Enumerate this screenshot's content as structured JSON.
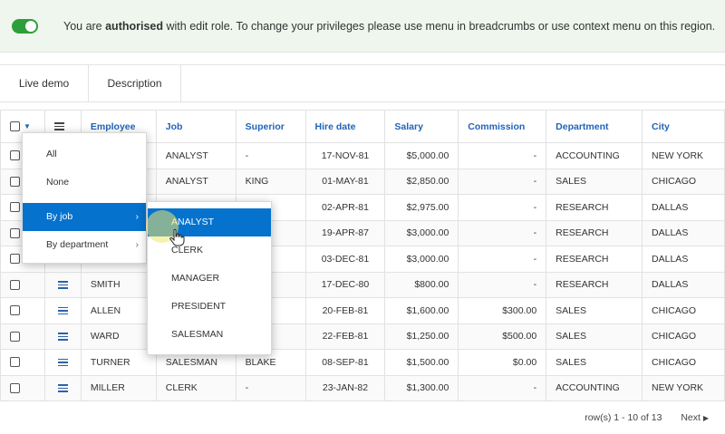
{
  "banner": {
    "msg_prefix": "You are ",
    "msg_bold": "authorised",
    "msg_suffix": " with edit role. To change your privileges please use menu in breadcrumbs or use context menu on this region.",
    "toggle_state": "on",
    "accent": "#2e9e3a"
  },
  "tabs": [
    {
      "label": "Live demo"
    },
    {
      "label": "Description"
    }
  ],
  "grid": {
    "headers": {
      "employee": "Employee",
      "job": "Job",
      "superior": "Superior",
      "hire_date": "Hire date",
      "salary": "Salary",
      "commission": "Commission",
      "department": "Department",
      "city": "City"
    },
    "rows": [
      {
        "employee": "",
        "job": "ANALYST",
        "superior": "-",
        "hire_date": "17-NOV-81",
        "salary": "$5,000.00",
        "commission": "-",
        "department": "ACCOUNTING",
        "city": "NEW YORK"
      },
      {
        "employee": "",
        "job": "ANALYST",
        "superior": "KING",
        "hire_date": "01-MAY-81",
        "salary": "$2,850.00",
        "commission": "-",
        "department": "SALES",
        "city": "CHICAGO"
      },
      {
        "employee": "",
        "job": "",
        "superior": "",
        "hire_date": "02-APR-81",
        "salary": "$2,975.00",
        "commission": "-",
        "department": "RESEARCH",
        "city": "DALLAS"
      },
      {
        "employee": "",
        "job": "",
        "superior": "",
        "hire_date": "19-APR-87",
        "salary": "$3,000.00",
        "commission": "-",
        "department": "RESEARCH",
        "city": "DALLAS"
      },
      {
        "employee": "",
        "job": "",
        "superior": "",
        "hire_date": "03-DEC-81",
        "salary": "$3,000.00",
        "commission": "-",
        "department": "RESEARCH",
        "city": "DALLAS"
      },
      {
        "employee": "SMITH",
        "job": "",
        "superior": "",
        "hire_date": "17-DEC-80",
        "salary": "$800.00",
        "commission": "-",
        "department": "RESEARCH",
        "city": "DALLAS"
      },
      {
        "employee": "ALLEN",
        "job": "",
        "superior": "",
        "hire_date": "20-FEB-81",
        "salary": "$1,600.00",
        "commission": "$300.00",
        "department": "SALES",
        "city": "CHICAGO"
      },
      {
        "employee": "WARD",
        "job": "",
        "superior": "",
        "hire_date": "22-FEB-81",
        "salary": "$1,250.00",
        "commission": "$500.00",
        "department": "SALES",
        "city": "CHICAGO"
      },
      {
        "employee": "TURNER",
        "job": "SALESMAN",
        "superior": "BLAKE",
        "hire_date": "08-SEP-81",
        "salary": "$1,500.00",
        "commission": "$0.00",
        "department": "SALES",
        "city": "CHICAGO"
      },
      {
        "employee": "MILLER",
        "job": "CLERK",
        "superior": "-",
        "hire_date": "23-JAN-82",
        "salary": "$1,300.00",
        "commission": "-",
        "department": "ACCOUNTING",
        "city": "NEW YORK"
      }
    ]
  },
  "pagination": {
    "range": "row(s) 1 - 10 of 13",
    "next": "Next"
  },
  "select_menu": {
    "items": [
      {
        "label": "All"
      },
      {
        "label": "None"
      },
      {
        "label": "By job",
        "has_submenu": true,
        "active": true
      },
      {
        "label": "By department",
        "has_submenu": true
      }
    ]
  },
  "job_submenu": {
    "items": [
      {
        "label": "ANALYST",
        "active": true
      },
      {
        "label": "CLERK"
      },
      {
        "label": "MANAGER"
      },
      {
        "label": "PRESIDENT"
      },
      {
        "label": "SALESMAN"
      }
    ]
  },
  "colors": {
    "header_text": "#1f63b8",
    "menu_active": "#0572ce"
  }
}
